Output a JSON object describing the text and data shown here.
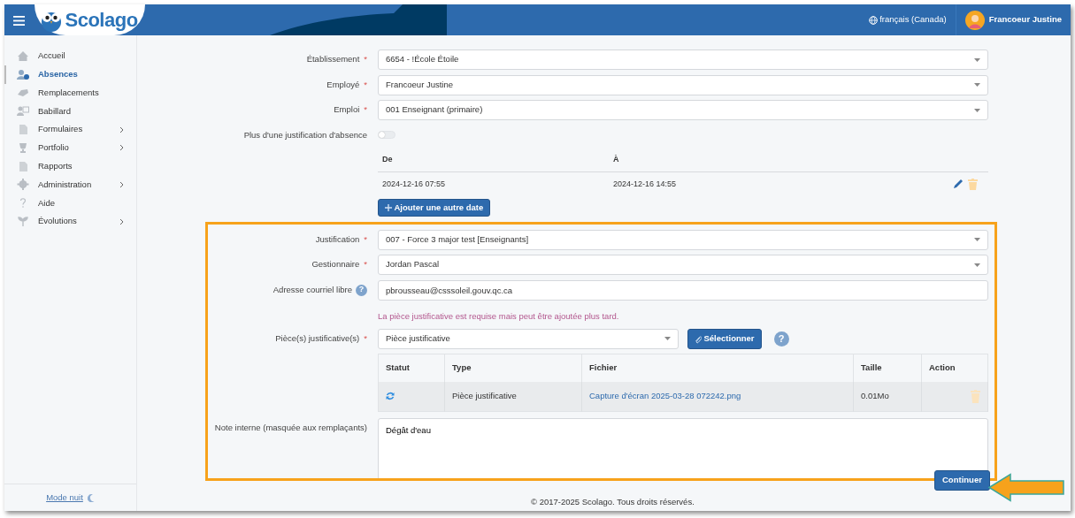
{
  "header": {
    "brand": "Scolago",
    "language": "français (Canada)",
    "user": "Francoeur Justine"
  },
  "sidebar": {
    "items": [
      {
        "label": "Accueil",
        "selected": false,
        "submenu": false
      },
      {
        "label": "Absences",
        "selected": true,
        "submenu": false
      },
      {
        "label": "Remplacements",
        "selected": false,
        "submenu": false
      },
      {
        "label": "Babillard",
        "selected": false,
        "submenu": false
      },
      {
        "label": "Formulaires",
        "selected": false,
        "submenu": true
      },
      {
        "label": "Portfolio",
        "selected": false,
        "submenu": true
      },
      {
        "label": "Rapports",
        "selected": false,
        "submenu": false
      },
      {
        "label": "Administration",
        "selected": false,
        "submenu": true
      },
      {
        "label": "Aide",
        "selected": false,
        "submenu": false
      },
      {
        "label": "Évolutions",
        "selected": false,
        "submenu": true
      }
    ],
    "night_mode": "Mode nuit"
  },
  "form": {
    "fields": [
      {
        "kind": "select",
        "label": "Établissement",
        "required_mark": "*",
        "value": "6654 - !École Étoile"
      },
      {
        "kind": "select",
        "label": "Employé",
        "required_mark": "*",
        "value": "Francoeur Justine"
      },
      {
        "kind": "select",
        "label": "Emploi",
        "required_mark": "*",
        "value": "001 Enseignant (primaire)"
      },
      {
        "kind": "toggle",
        "label": "Plus d'une justification d'absence",
        "on": false
      }
    ],
    "dates": {
      "columns": [
        "De",
        "À"
      ],
      "rows": [
        {
          "from": "2024-12-16 07:55",
          "to": "2024-12-16 14:55"
        }
      ],
      "add_button": "Ajouter une autre date"
    },
    "highlighted_fields": [
      {
        "kind": "select",
        "label": "Justification",
        "required_mark": "*",
        "value": "007 - Force 3 major test [Enseignants]"
      },
      {
        "kind": "select",
        "label": "Gestionnaire",
        "required_mark": "*",
        "value": "Jordan Pascal"
      },
      {
        "kind": "text",
        "label": "Adresse courriel libre",
        "help": "?",
        "value": "pbrousseau@csssoleil.gouv.qc.ca"
      }
    ],
    "attachment_notice": "La pièce justificative est requise mais peut être ajoutée plus tard.",
    "attachments": {
      "label": "Pièce(s) justificative(s)",
      "required_mark": "*",
      "type_value": "Pièce justificative",
      "select_button": "Sélectionner",
      "help_button": "?",
      "columns": [
        "Statut",
        "Type",
        "Fichier",
        "Taille",
        "Action"
      ],
      "rows": [
        {
          "type": "Pièce justificative",
          "file": "Capture d'écran 2025-03-28 072242.png",
          "size": "0.01Mo"
        }
      ]
    },
    "note": {
      "label": "Note interne (masquée aux remplaçants)",
      "value": "Dégât d'eau"
    },
    "continue_button": "Continuer"
  },
  "footer": "© 2017-2025 Scolago. Tous droits réservés."
}
